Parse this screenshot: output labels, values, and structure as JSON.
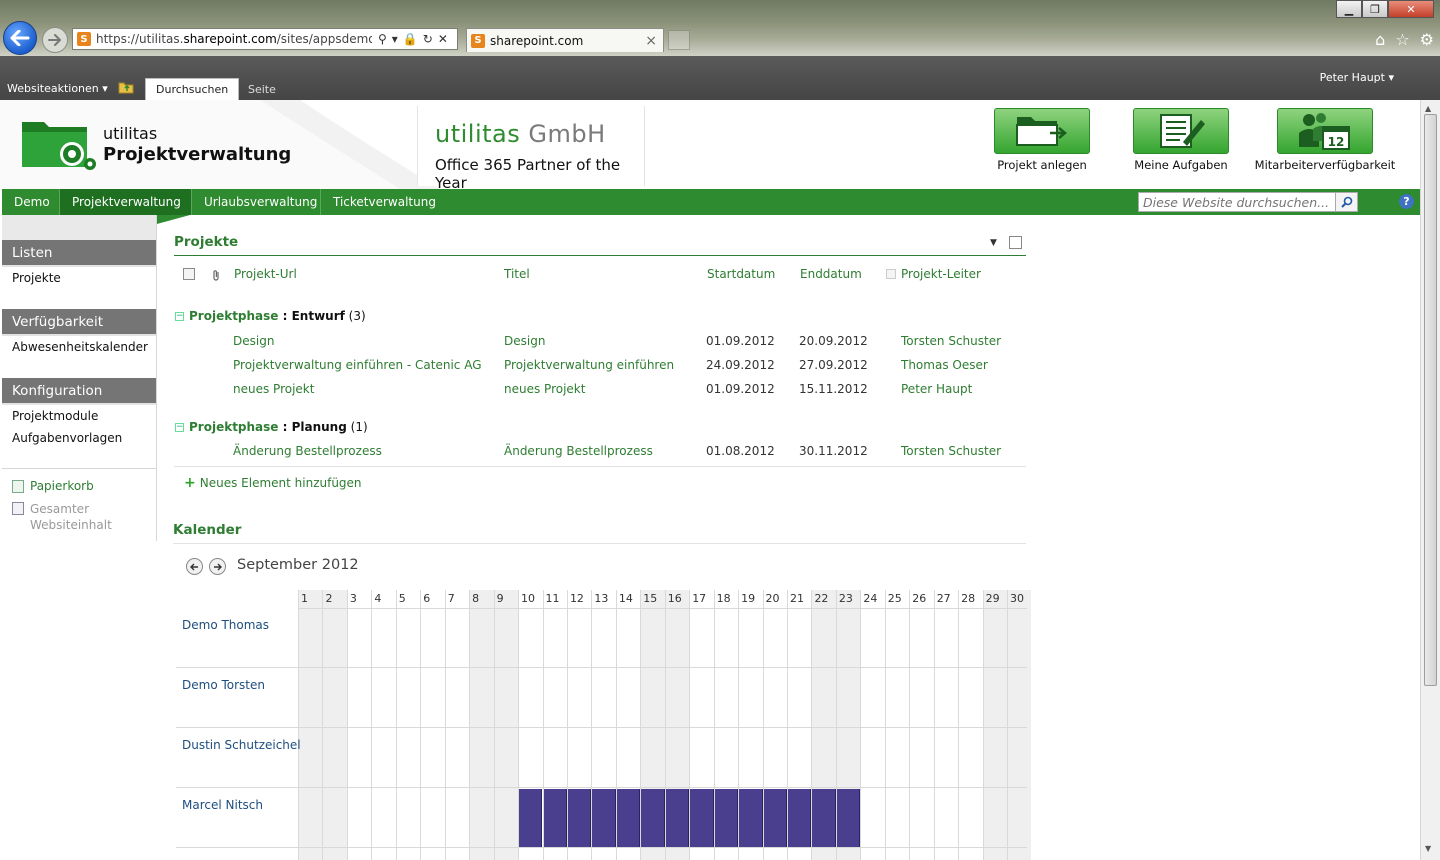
{
  "browser": {
    "url_prefix": "https://utilitas.",
    "url_domain": "sharepoint.com",
    "url_suffix": "/sites/appsdemo/Proj",
    "tab_title": "sharepoint.com",
    "favicon_letter": "S"
  },
  "ribbon": {
    "site_actions": "Websiteaktionen",
    "tabs": [
      "Durchsuchen",
      "Seite"
    ],
    "user": "Peter Haupt"
  },
  "header": {
    "logo_line1": "utilitas",
    "logo_line2": "Projektverwaltung",
    "company_name": "utilitas",
    "company_suffix": "GmbH",
    "tagline": "Office 365 Partner of the Year",
    "quick_buttons": [
      "Projekt anlegen",
      "Meine Aufgaben",
      "Mitarbeiterverfügbarkeit"
    ],
    "calendar_badge": "12"
  },
  "topnav": {
    "items": [
      "Demo",
      "Projektverwaltung",
      "Urlaubsverwaltung",
      "Ticketverwaltung"
    ],
    "search_placeholder": "Diese Website durchsuchen...",
    "help": "?"
  },
  "leftnav": {
    "sections": [
      {
        "header": "Listen",
        "items": [
          "Projekte"
        ]
      },
      {
        "header": "Verfügbarkeit",
        "items": [
          "Abwesenheitskalender"
        ]
      },
      {
        "header": "Konfiguration",
        "items": [
          "Projektmodule",
          "Aufgabenvorlagen"
        ]
      }
    ],
    "utilities": [
      "Papierkorb",
      "Gesamter Websiteinhalt"
    ]
  },
  "projekte": {
    "title": "Projekte",
    "columns": [
      "Projekt-Url",
      "Titel",
      "Startdatum",
      "Enddatum",
      "Projekt-Leiter"
    ],
    "groups": [
      {
        "label": "Projektphase",
        "value": " : Entwurf",
        "count": "(3)",
        "rows": [
          [
            "Design",
            "Design",
            "01.09.2012",
            "20.09.2012",
            "Torsten Schuster"
          ],
          [
            "Projektverwaltung einführen - Catenic AG",
            "Projektverwaltung einführen",
            "24.09.2012",
            "27.09.2012",
            "Thomas Oeser"
          ],
          [
            "neues Projekt",
            "neues Projekt",
            "01.09.2012",
            "15.11.2012",
            "Peter Haupt"
          ]
        ]
      },
      {
        "label": "Projektphase",
        "value": " : Planung",
        "count": "(1)",
        "rows": [
          [
            "Änderung Bestellprozess",
            "Änderung Bestellprozess",
            "01.08.2012",
            "30.11.2012",
            "Torsten Schuster"
          ]
        ]
      }
    ],
    "add_item": "Neues Element hinzufügen"
  },
  "kalender": {
    "title": "Kalender",
    "month": "September 2012",
    "days": [
      "1",
      "2",
      "3",
      "4",
      "5",
      "6",
      "7",
      "8",
      "9",
      "10",
      "11",
      "12",
      "13",
      "14",
      "15",
      "16",
      "17",
      "18",
      "19",
      "20",
      "21",
      "22",
      "23",
      "24",
      "25",
      "26",
      "27",
      "28",
      "29",
      "30"
    ],
    "weekend_days": [
      1,
      2,
      8,
      9,
      15,
      16,
      22,
      23,
      29,
      30
    ],
    "people": [
      "Demo Thomas",
      "Demo Torsten",
      "Dustin Schutzeichel",
      "Marcel Nitsch"
    ],
    "absence": {
      "person": "Marcel Nitsch",
      "from_day": 10,
      "to_day": 23,
      "color": "#4a3f8e"
    }
  },
  "colors": {
    "brand_green": "#2e8b2f",
    "link_green": "#2e7d32",
    "absence_purple": "#4a3f8e"
  }
}
